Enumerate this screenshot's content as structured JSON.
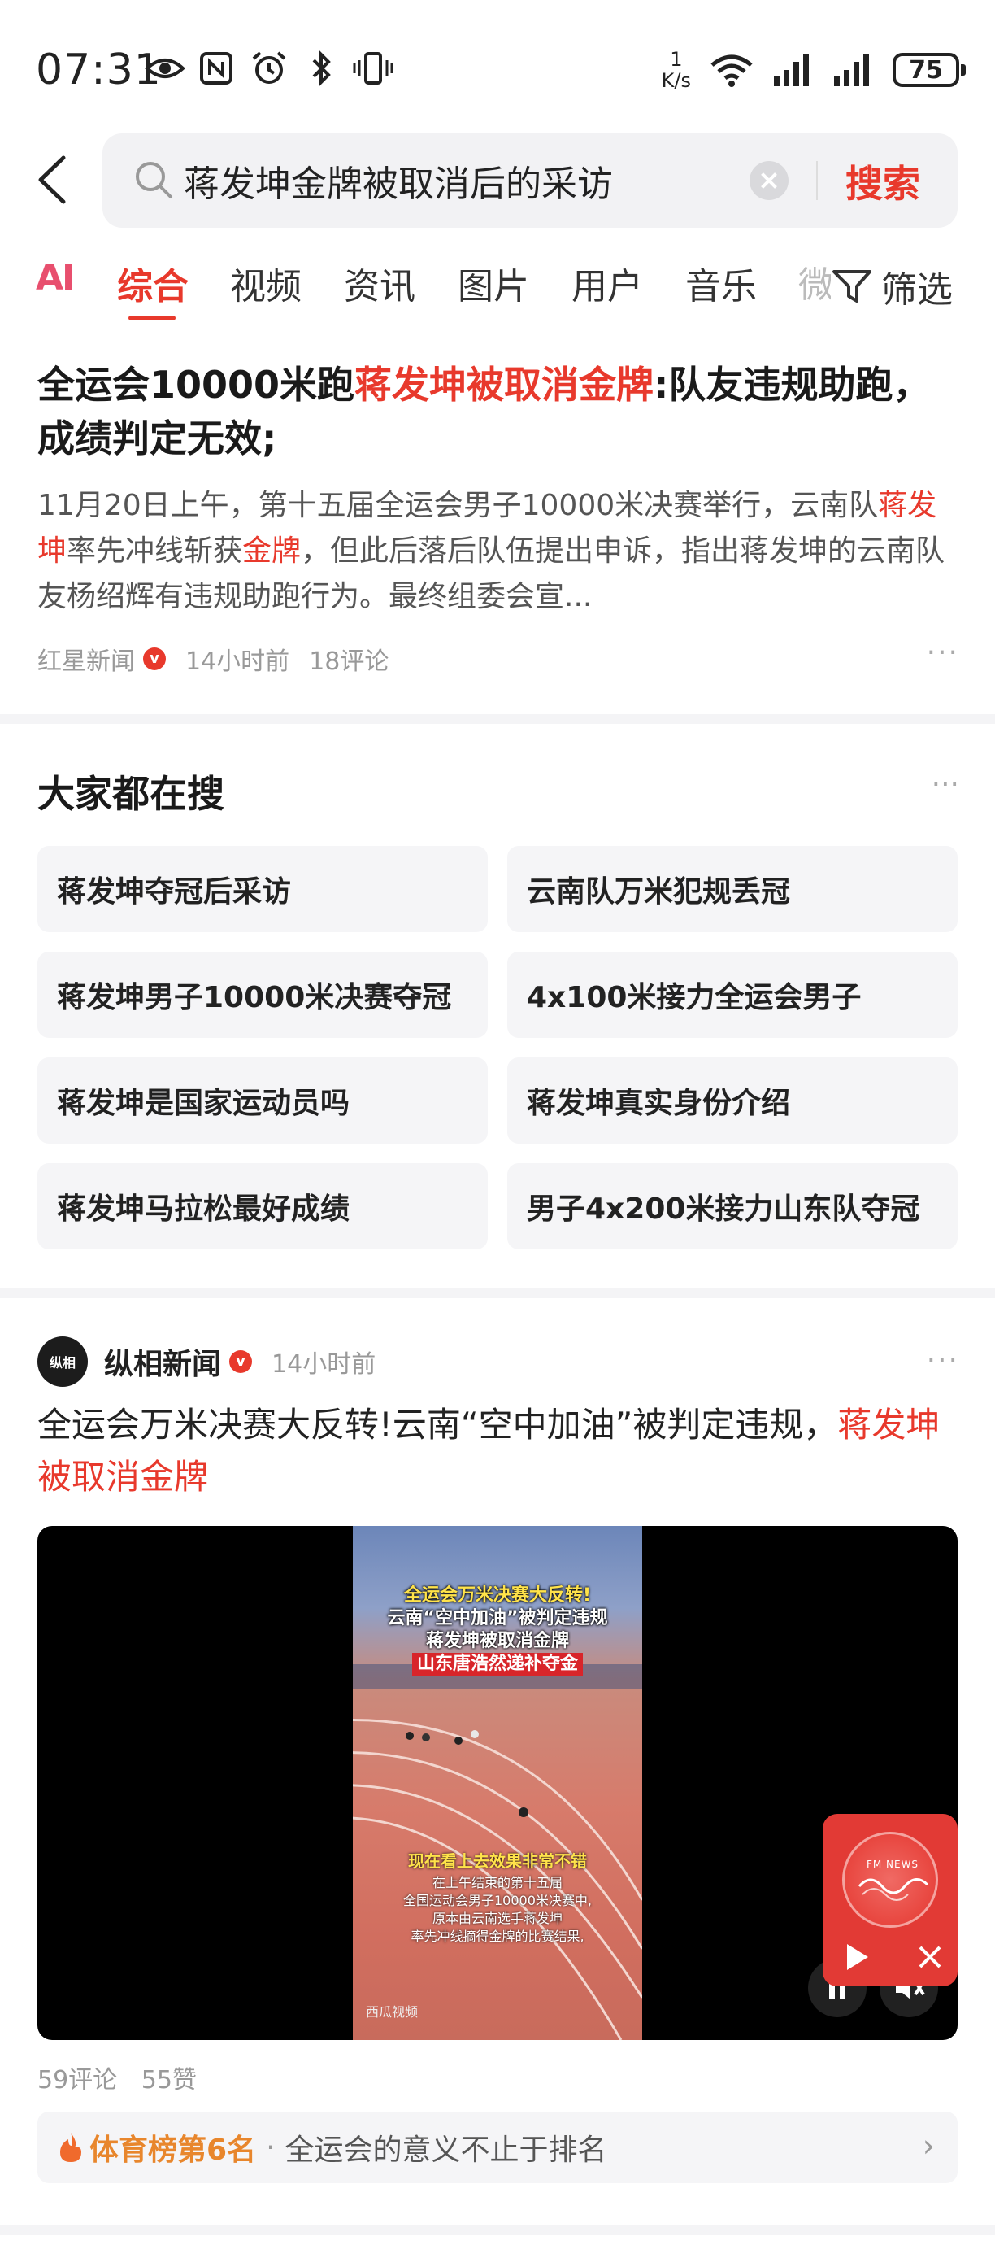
{
  "status_bar": {
    "time": "07:31",
    "net_speed_value": "1",
    "net_speed_unit": "K/s",
    "battery": "75"
  },
  "search": {
    "query": "蒋发坤金牌被取消后的采访",
    "submit_label": "搜索"
  },
  "tabs": {
    "ai": "AI",
    "items": [
      "综合",
      "视频",
      "资讯",
      "图片",
      "用户",
      "音乐"
    ],
    "partial": "微",
    "filter": "筛选"
  },
  "article1": {
    "title_part1": "全运会10000米跑",
    "title_highlight": "蒋发坤被取消金牌",
    "title_part2": ":队友违规助跑，成绩判定无效;",
    "summary_part1": "11月20日上午，第十五届全运会男子10000米决赛举行，云南队",
    "summary_hl1": "蒋发坤",
    "summary_part2": "率先冲线斩获",
    "summary_hl2": "金牌",
    "summary_part3": "，但此后落后队伍提出申诉，指出蒋发坤的云南队友杨绍辉有违规助跑行为。最终组委会宣...",
    "source": "红星新闻",
    "time": "14小时前",
    "comments": "18评论"
  },
  "hot_searches": {
    "title": "大家都在搜",
    "items": [
      "蒋发坤夺冠后采访",
      "云南队万米犯规丢冠",
      "蒋发坤男子10000米决赛夺冠",
      "4x100米接力全运会男子",
      "蒋发坤是国家运动员吗",
      "蒋发坤真实身份介绍",
      "蒋发坤马拉松最好成绩",
      "男子4x200米接力山东队夺冠"
    ]
  },
  "article2": {
    "avatar_text": "纵相",
    "source": "纵相新闻",
    "time": "14小时前",
    "title_part1": "全运会万米决赛大反转!云南“空中加油”被判定违规，",
    "title_highlight": "蒋发坤被取消金牌",
    "video": {
      "line1": "全运会万米决赛大反转!",
      "line2": "云南“空中加油”被判定违规",
      "line3": "蒋发坤被取消金牌",
      "line4": "山东唐浩然递补夺金",
      "caption_yellow": "现在看上去效果非常不错",
      "caption1": "在上午结束的第十五届",
      "caption2": "全国运动会男子10000米决赛中,",
      "caption3": "原本由云南选手蒋发坤",
      "caption4": "率先冲线摘得金牌的比赛结果,",
      "watermark": "西瓜视频"
    },
    "fm_label": "FM NEWS",
    "comments": "59评论",
    "likes": "55赞",
    "rank_label": "体育榜第6名",
    "rank_sep": "·",
    "rank_text": "全运会的意义不止于排名"
  },
  "colors": {
    "accent": "#e8392c",
    "rank": "#e8862c",
    "meta": "#999999"
  }
}
